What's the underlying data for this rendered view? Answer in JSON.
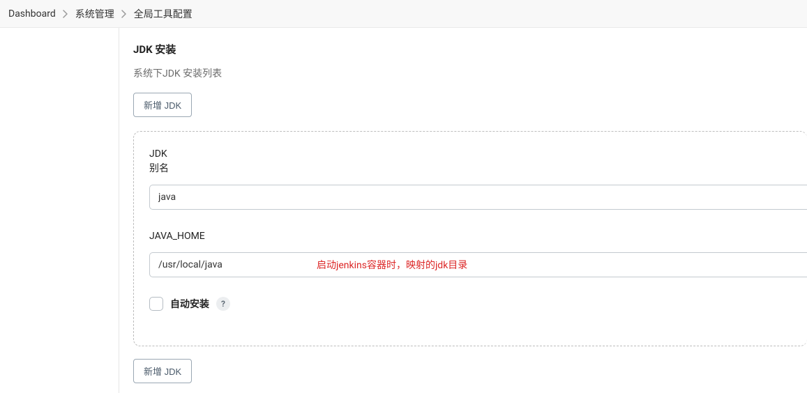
{
  "breadcrumb": {
    "items": [
      "Dashboard",
      "系统管理",
      "全局工具配置"
    ]
  },
  "section": {
    "title": "JDK 安装",
    "sub": "系统下JDK 安装列表"
  },
  "buttons": {
    "add_top": "新增 JDK",
    "add_bottom": "新增 JDK"
  },
  "jdk_entry": {
    "header": "JDK",
    "alias_label": "别名",
    "alias_value": "java",
    "javahome_label": "JAVA_HOME",
    "javahome_value": "/usr/local/java",
    "annotation": "启动jenkins容器时，映射的jdk目录",
    "auto_install_label": "自动安装",
    "help_glyph": "?"
  }
}
